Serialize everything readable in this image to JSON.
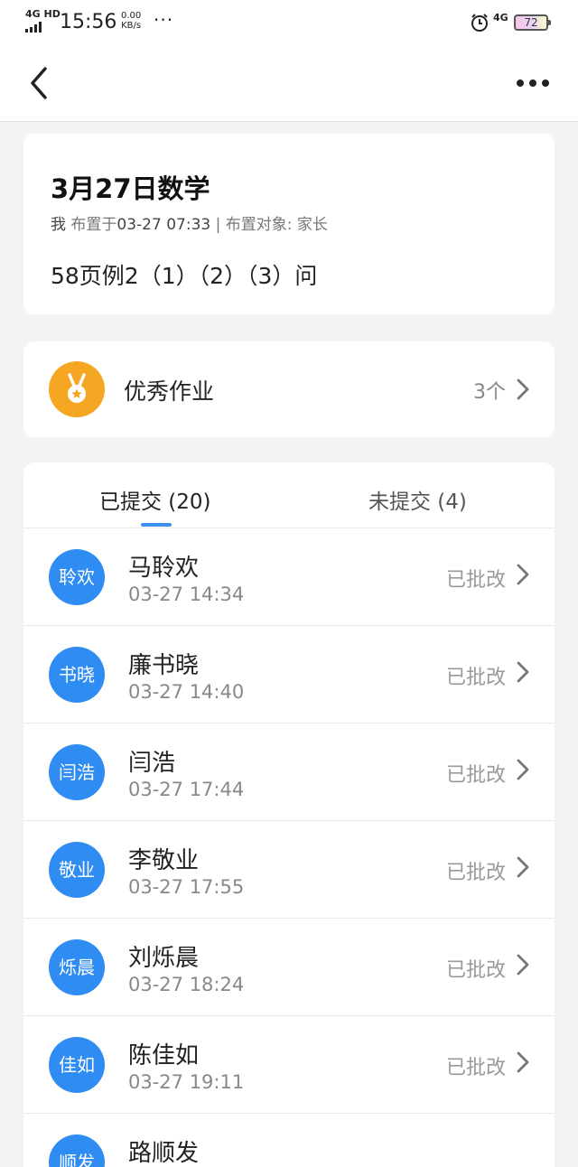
{
  "status_bar": {
    "network": "4G HD",
    "time": "15:56",
    "speed_value": "0.00",
    "speed_unit": "KB/s",
    "more": "···",
    "net_right": "4G",
    "battery": "72"
  },
  "nav": {
    "back_icon": "chevron-left-icon",
    "more_icon": "more-horizontal-icon"
  },
  "homework": {
    "title": "3月27日数学",
    "author": "我",
    "assigned_prefix": " 布置于",
    "assigned_time": "03-27 07:33",
    "target": " | 布置对象: 家长",
    "content": "58页例2（1）（2）（3）问"
  },
  "excellent": {
    "label": "优秀作业",
    "count": "3个",
    "icon": "medal-icon",
    "icon_color": "#f5a623"
  },
  "tabs": {
    "submitted": "已提交 (20)",
    "unsubmitted": "未提交 (4)",
    "accent_color": "#3b8ff0"
  },
  "submissions": [
    {
      "avatar": "聆欢",
      "name": "马聆欢",
      "time": "03-27 14:34",
      "status": "已批改"
    },
    {
      "avatar": "书晓",
      "name": "廉书晓",
      "time": "03-27 14:40",
      "status": "已批改"
    },
    {
      "avatar": "闫浩",
      "name": "闫浩",
      "time": "03-27 17:44",
      "status": "已批改"
    },
    {
      "avatar": "敬业",
      "name": "李敬业",
      "time": "03-27 17:55",
      "status": "已批改"
    },
    {
      "avatar": "烁晨",
      "name": "刘烁晨",
      "time": "03-27 18:24",
      "status": "已批改"
    },
    {
      "avatar": "佳如",
      "name": "陈佳如",
      "time": "03-27 19:11",
      "status": "已批改"
    },
    {
      "avatar": "顺发",
      "name": "路顺发",
      "time": "",
      "status": ""
    }
  ]
}
